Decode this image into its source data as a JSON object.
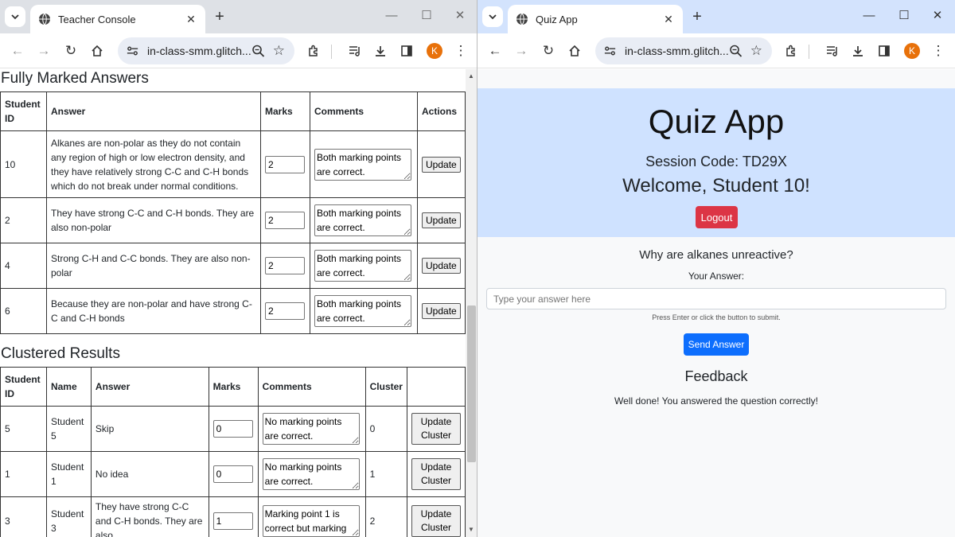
{
  "left_window": {
    "tab_title": "Teacher Console",
    "url": "in-class-smm.glitch...",
    "avatar_letter": "K",
    "fully_marked": {
      "heading": "Fully Marked Answers",
      "headers": [
        "Student ID",
        "Answer",
        "Marks",
        "Comments",
        "Actions"
      ],
      "rows": [
        {
          "id": "10",
          "answer": "Alkanes are non-polar as they do not contain any region of high or low electron density, and they have relatively strong C-C and C-H bonds which do not break under normal conditions.",
          "marks": "2",
          "comment": "Both marking points are correct.",
          "action": "Update"
        },
        {
          "id": "2",
          "answer": "They have strong C-C and C-H bonds. They are also non-polar",
          "marks": "2",
          "comment": "Both marking points are correct.",
          "action": "Update"
        },
        {
          "id": "4",
          "answer": "Strong C-H and C-C bonds. They are also non-polar",
          "marks": "2",
          "comment": "Both marking points are correct.",
          "action": "Update"
        },
        {
          "id": "6",
          "answer": "Because they are non-polar and have strong C-C and C-H bonds",
          "marks": "2",
          "comment": "Both marking points are correct.",
          "action": "Update"
        }
      ]
    },
    "clustered": {
      "heading": "Clustered Results",
      "headers": [
        "Student ID",
        "Name",
        "Answer",
        "Marks",
        "Comments",
        "Cluster",
        ""
      ],
      "rows": [
        {
          "id": "5",
          "name": "Student 5",
          "answer": "Skip",
          "marks": "0",
          "comment": "No marking points are correct.",
          "cluster": "0",
          "action": "Update Cluster"
        },
        {
          "id": "1",
          "name": "Student 1",
          "answer": "No idea",
          "marks": "0",
          "comment": "No marking points are correct.",
          "cluster": "1",
          "action": "Update Cluster"
        },
        {
          "id": "3",
          "name": "Student 3",
          "answer": "They have strong C-C and C-H bonds. They are also",
          "marks": "1",
          "comment": "Marking point 1 is correct but marking",
          "cluster": "2",
          "action": "Update Cluster"
        }
      ]
    }
  },
  "right_window": {
    "tab_title": "Quiz App",
    "url": "in-class-smm.glitch...",
    "avatar_letter": "K",
    "app_title": "Quiz App",
    "session_code": "Session Code: TD29X",
    "welcome": "Welcome, Student 10!",
    "logout_label": "Logout",
    "question": "Why are alkanes unreactive?",
    "answer_label": "Your Answer:",
    "answer_placeholder": "Type your answer here",
    "hint": "Press Enter or click the button to submit.",
    "send_label": "Send Answer",
    "feedback_heading": "Feedback",
    "feedback_message": "Well done! You answered the question correctly!"
  },
  "colors": {
    "left_titlebar": "#dee1e6",
    "right_titlebar": "#d3e3fd",
    "hero_bg": "#cfe2ff",
    "logout": "#dc3545",
    "send": "#0d6efd",
    "avatar": "#e8710a"
  }
}
